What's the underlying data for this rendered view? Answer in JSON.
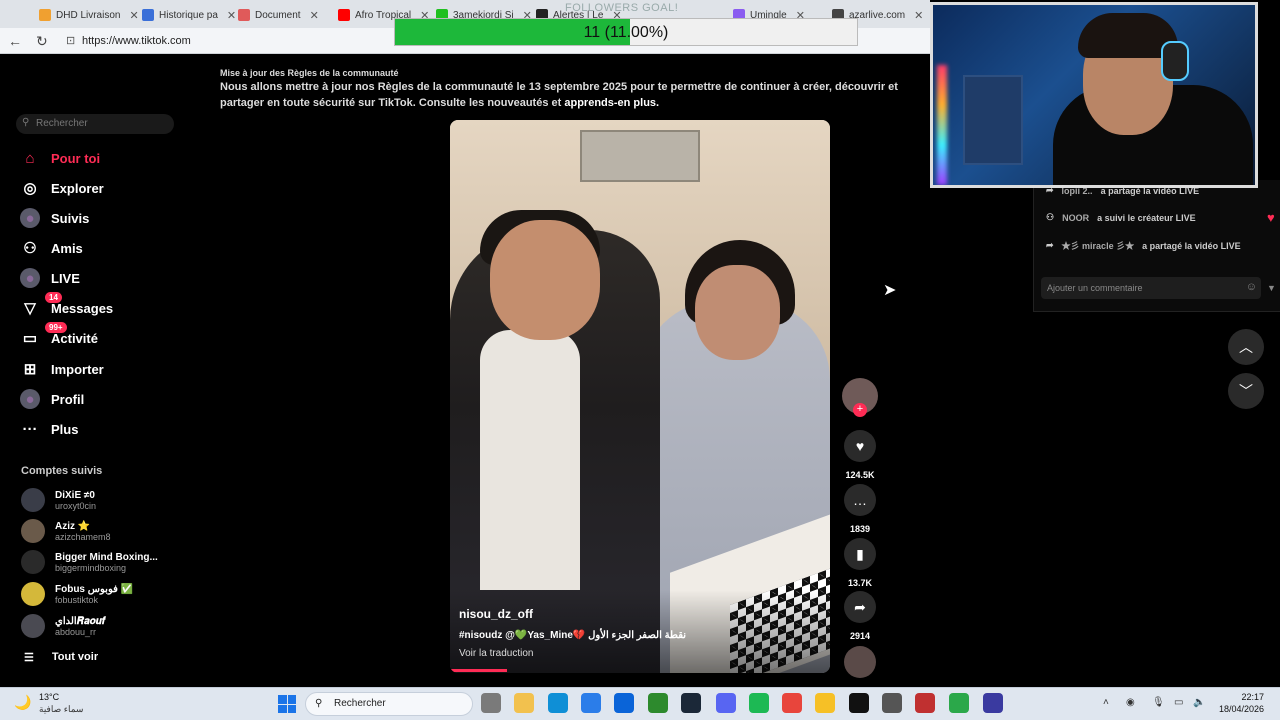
{
  "browser": {
    "tabs": [
      {
        "label": "DHD Livraison",
        "color": "#f0a030"
      },
      {
        "label": "Historique pa",
        "color": "#3a6fd8"
      },
      {
        "label": "Document",
        "color": "#e05a5a"
      },
      {
        "label": "Afro Tropical",
        "color": "#ff0000"
      },
      {
        "label": "3amekiordi Si",
        "color": "#20c020"
      },
      {
        "label": "Alertes | Le",
        "color": "#222222"
      },
      {
        "label": "Umingle",
        "color": "#8a5cf0"
      },
      {
        "label": "azarlive.com",
        "color": "#444444"
      }
    ],
    "url": "https://www.tiktok.com"
  },
  "overlay": {
    "goal_label": "FOLLOWERS GOAL!",
    "goal_text": "11 (11.00%)",
    "goal_fraction": 0.11,
    "goal_color": "#1db83a"
  },
  "notice": {
    "title": "Mise à jour des Règles de la communauté",
    "body": "Nous allons mettre à jour nos Règles de la communauté le 13 septembre 2025 pour te permettre de continuer à créer, découvrir et partager en toute sécurité sur TikTok. Consulte les nouveautés et",
    "link": "apprends-en plus."
  },
  "sidebar": {
    "search_placeholder": "Rechercher",
    "items": [
      {
        "label": "Pour toi",
        "icon": "home-icon",
        "glyph": "⌂"
      },
      {
        "label": "Explorer",
        "icon": "compass-icon",
        "glyph": "◎"
      },
      {
        "label": "Suivis",
        "icon": "following-avatar-icon",
        "glyph": "●"
      },
      {
        "label": "Amis",
        "icon": "friends-icon",
        "glyph": "⚇"
      },
      {
        "label": "LIVE",
        "icon": "live-avatar-icon",
        "glyph": "●"
      },
      {
        "label": "Messages",
        "icon": "messages-icon",
        "glyph": "▽",
        "badge": "14"
      },
      {
        "label": "Activité",
        "icon": "activity-icon",
        "glyph": "▭",
        "badge": "99+"
      },
      {
        "label": "Importer",
        "icon": "upload-icon",
        "glyph": "⊞"
      },
      {
        "label": "Profil",
        "icon": "profile-avatar-icon",
        "glyph": "●"
      },
      {
        "label": "Plus",
        "icon": "more-icon",
        "glyph": "···"
      }
    ],
    "followed_title": "Comptes suivis",
    "accounts": [
      {
        "name": "DiXiE ≠0",
        "handle": "uroxyt0cin"
      },
      {
        "name": "Aziz ⭐",
        "handle": "azizchamem8"
      },
      {
        "name": "Bigger Mind Boxing...",
        "handle": "biggermindboxing"
      },
      {
        "name": "Fobus فوبوس ✅",
        "handle": "fobustiktok"
      },
      {
        "name": "الداي𝑹𝒂𝒐𝒖𝒇",
        "handle": "abdouu_rr"
      }
    ],
    "see_all": "Tout voir"
  },
  "video": {
    "author": "nisou_dz_off",
    "caption": "#nisoudz @💚Yas_Mine💔 نقطة الصفر الجزء الأول",
    "translate": "Voir la traduction",
    "progress": 0.15
  },
  "actions": {
    "likes": "124.5K",
    "comments": "1839",
    "saves": "13.7K",
    "shares": "2914"
  },
  "chat": {
    "rows": [
      {
        "who": "lopii 2..",
        "text": "a partagé la vidéo LIVE"
      },
      {
        "who": "NOOR",
        "text": "a suivi le créateur LIVE"
      },
      {
        "who": "★彡 miracle 彡★",
        "text": "a partagé la vidéo LIVE"
      }
    ],
    "input_placeholder": "Ajouter un commentaire"
  },
  "taskbar": {
    "temp": "13°C",
    "weather": "سماء صافية",
    "search": "Rechercher",
    "time": "22:17",
    "date": "18/04/2026"
  }
}
